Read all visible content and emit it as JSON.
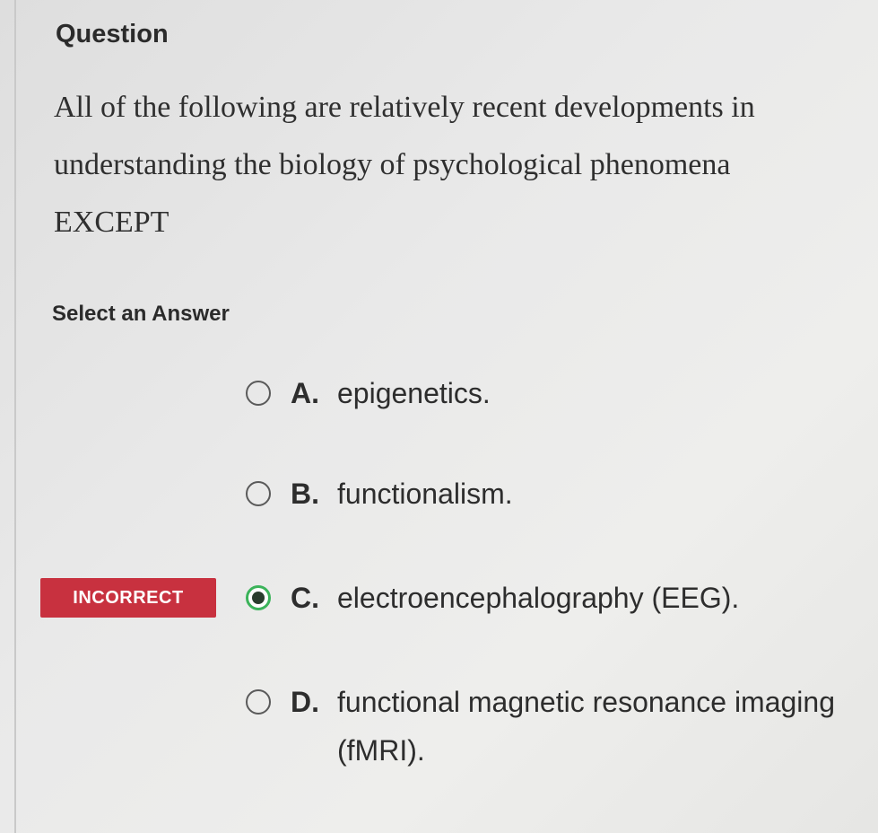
{
  "question": {
    "heading": "Question",
    "text": "All of the following are relatively recent developments in understanding the biology of psychological phenomena EXCEPT"
  },
  "select_label": "Select an Answer",
  "options": [
    {
      "letter": "A.",
      "text": "epigenetics.",
      "selected": false
    },
    {
      "letter": "B.",
      "text": "functionalism.",
      "selected": false
    },
    {
      "letter": "C.",
      "text": "electroencephalography (EEG).",
      "selected": true
    },
    {
      "letter": "D.",
      "text": "functional magnetic resonance imaging (fMRI).",
      "selected": false
    }
  ],
  "result_badge": {
    "label": "INCORRECT",
    "color": "#c8313f"
  },
  "colors": {
    "selected_ring": "#3bb35a",
    "badge": "#c8313f"
  }
}
